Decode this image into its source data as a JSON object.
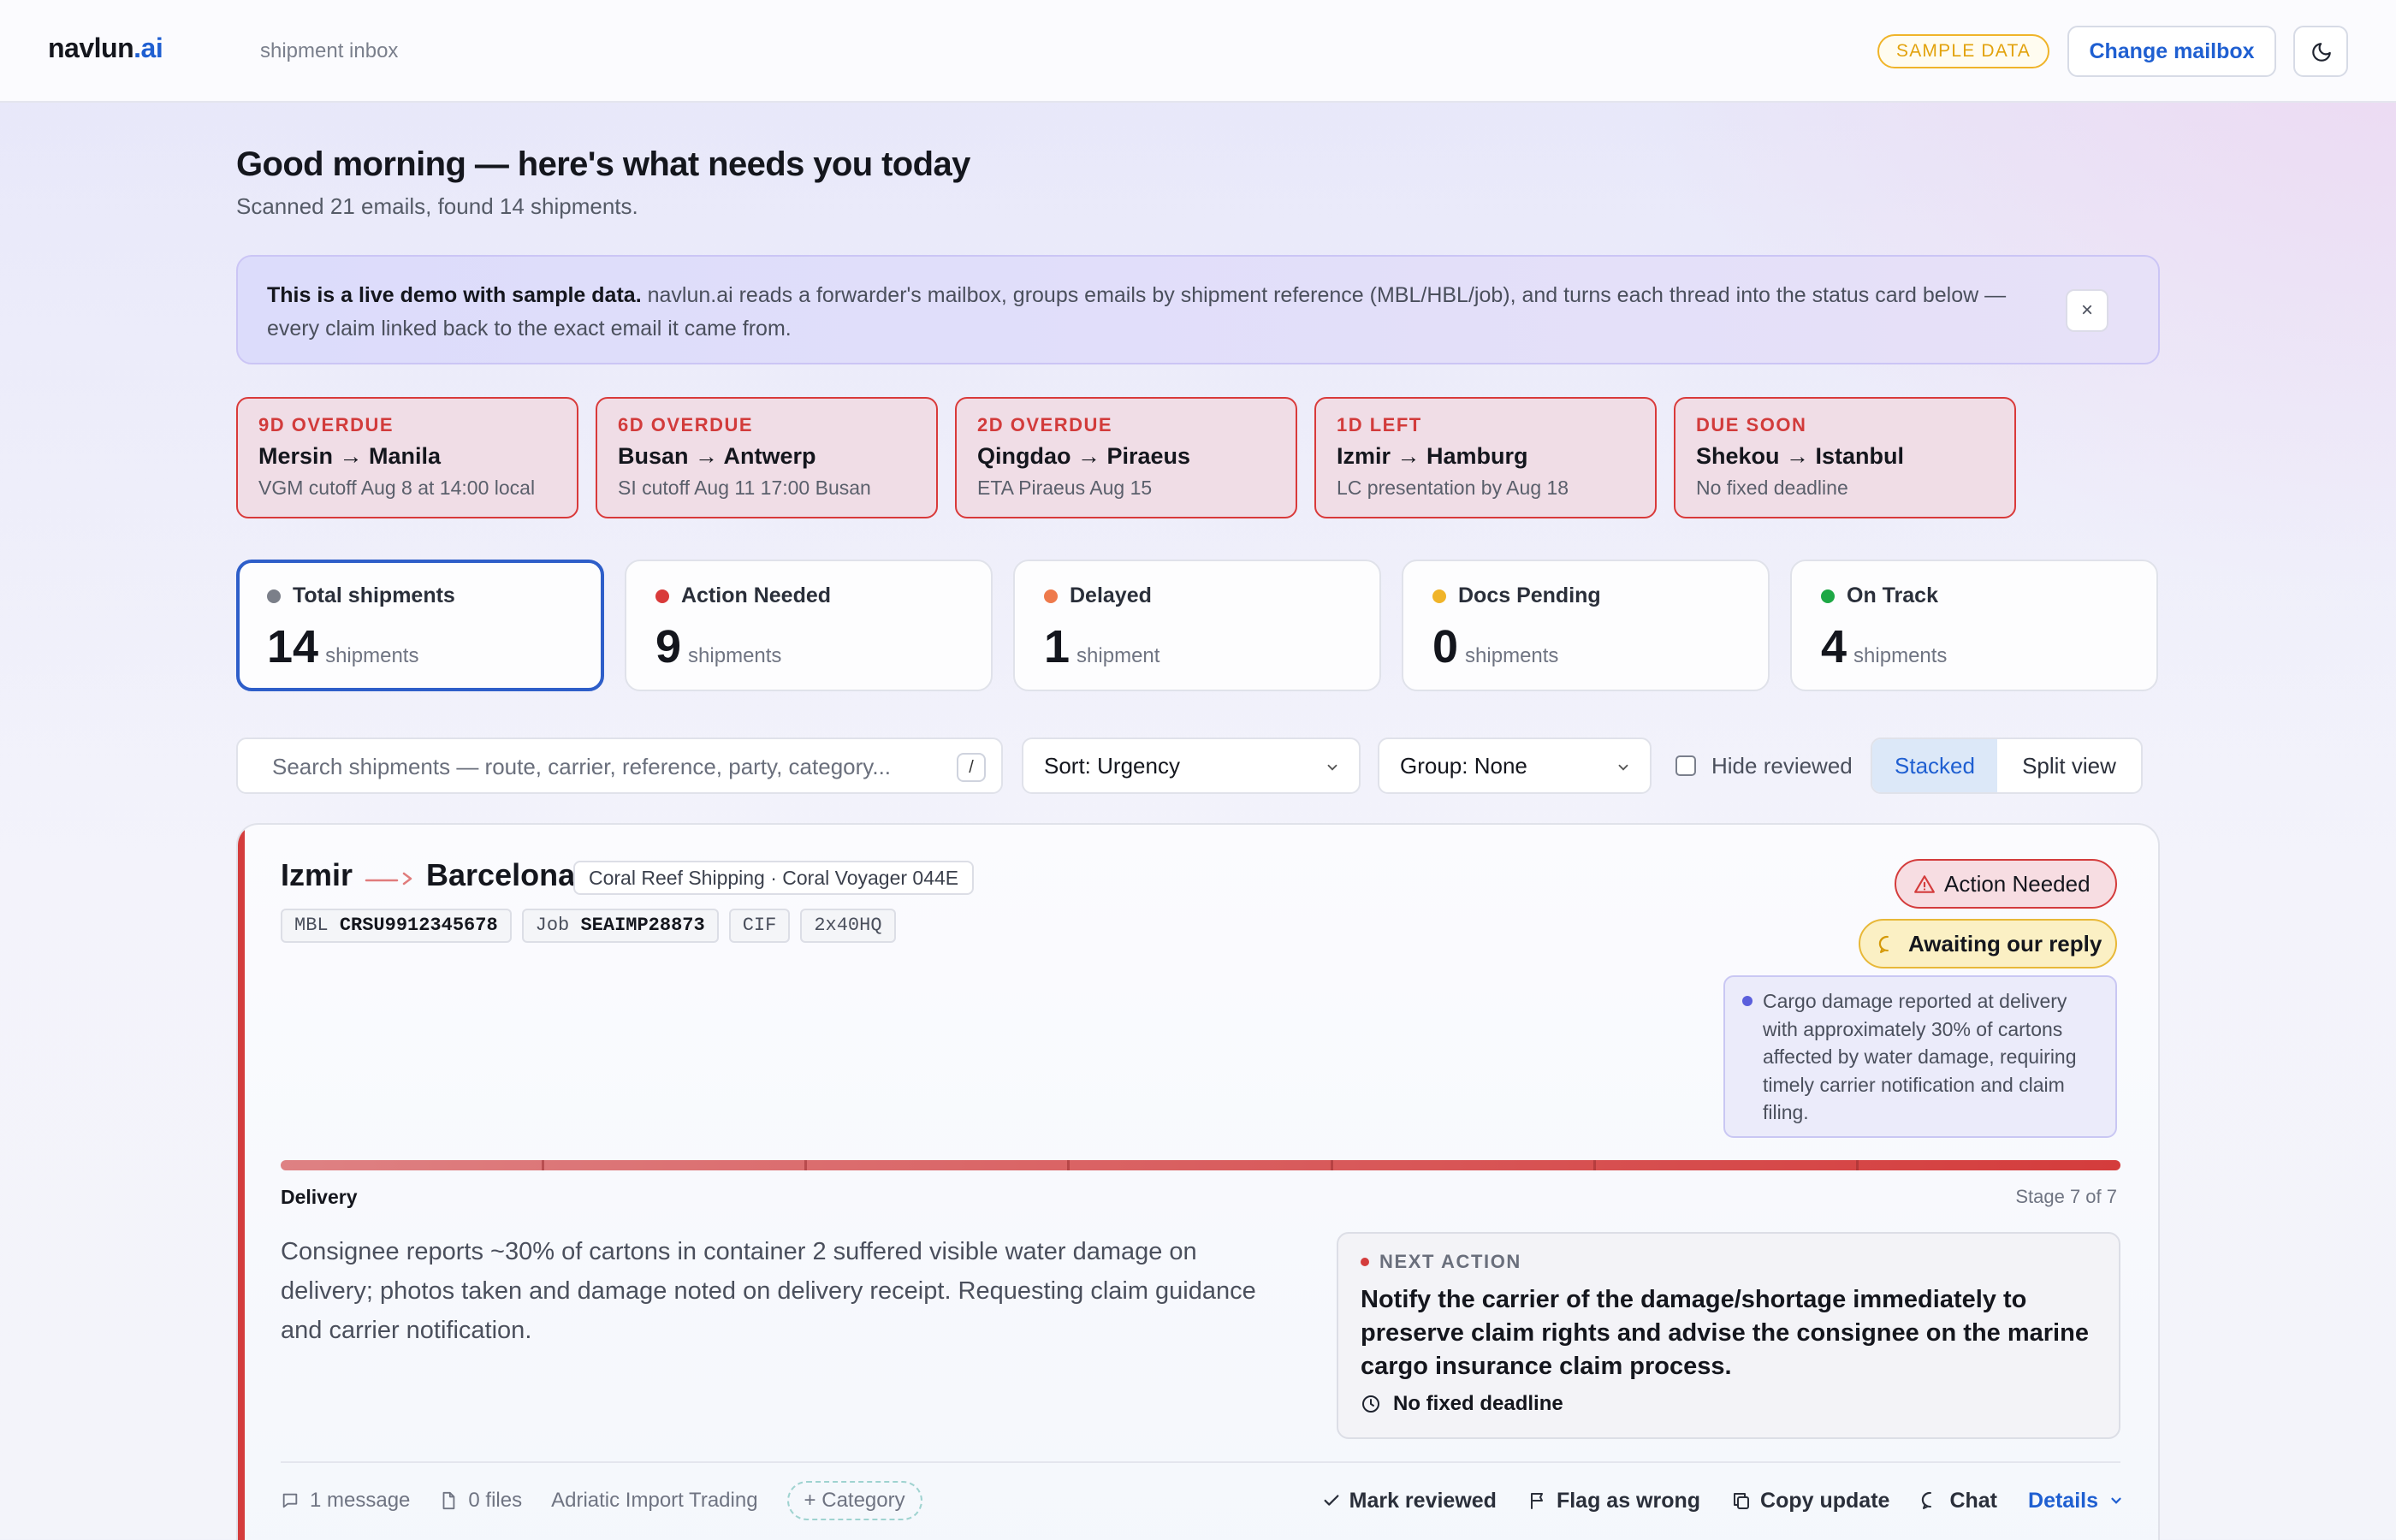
{
  "header": {
    "logo_main": "navlun",
    "logo_accent": ".ai",
    "subtitle": "shipment inbox",
    "sample_badge": "SAMPLE DATA",
    "change_mailbox": "Change mailbox",
    "theme_icon": "moon-icon"
  },
  "greeting": {
    "title": "Good morning — here's what needs you today",
    "scanned": "Scanned 21 emails, found 14 shipments."
  },
  "banner": {
    "bold": "This is a live demo with sample data.",
    "text": " navlun.ai reads a forwarder's mailbox, groups emails by shipment reference (MBL/HBL/job), and turns each thread into the status card below — every claim linked back to the exact email it came from.",
    "close": "×"
  },
  "deadlines": [
    {
      "status": "9D OVERDUE",
      "route": "Mersin → Manila",
      "note": "VGM cutoff Aug 8 at 14:00 local"
    },
    {
      "status": "6D OVERDUE",
      "route": "Busan → Antwerp",
      "note": "SI cutoff Aug 11 17:00 Busan"
    },
    {
      "status": "2D OVERDUE",
      "route": "Qingdao → Piraeus",
      "note": "ETA Piraeus Aug 15"
    },
    {
      "status": "1D LEFT",
      "route": "Izmir → Hamburg",
      "note": "LC presentation by Aug 18"
    },
    {
      "status": "DUE SOON",
      "route": "Shekou → Istanbul",
      "note": "No fixed deadline"
    }
  ],
  "stats": [
    {
      "label": "Total shipments",
      "value": "14",
      "unit": "shipments",
      "color": "#7b7f89"
    },
    {
      "label": "Action Needed",
      "value": "9",
      "unit": "shipments",
      "color": "#d93a3a"
    },
    {
      "label": "Delayed",
      "value": "1",
      "unit": "shipment",
      "color": "#ee7a4c"
    },
    {
      "label": "Docs Pending",
      "value": "0",
      "unit": "shipments",
      "color": "#f0b429"
    },
    {
      "label": "On Track",
      "value": "4",
      "unit": "shipments",
      "color": "#1ea845"
    }
  ],
  "toolbar": {
    "search_placeholder": "Search shipments — route, carrier, reference, party, category...",
    "search_kbd": "/",
    "sort": "Sort: Urgency",
    "group": "Group: None",
    "hide_reviewed": "Hide reviewed",
    "view_stacked": "Stacked",
    "view_split": "Split view"
  },
  "shipment": {
    "origin": "Izmir",
    "destination": "Barcelona",
    "carrier": "Coral Reef Shipping · Coral Voyager 044E",
    "mbl_label": "MBL",
    "mbl": "CRSU9912345678",
    "job_label": "Job",
    "job": "SEAIMP28873",
    "incoterm": "CIF",
    "equipment": "2x40HQ",
    "status": "Action Needed",
    "awaiting": "Awaiting our reply",
    "insight": "Cargo damage reported at delivery with approximately 30% of cartons affected by water damage, requiring timely carrier notification and claim filing.",
    "stage_name": "Delivery",
    "stage_progress": "Stage 7 of 7",
    "summary": "Consignee reports ~30% of cartons in container 2 suffered visible water damage on delivery; photos taken and damage noted on delivery receipt. Requesting claim guidance and carrier notification.",
    "next_action_label": "NEXT ACTION",
    "next_action": "Notify the carrier of the damage/shortage immediately to preserve claim rights and advise the consignee on the marine cargo insurance claim process.",
    "deadline": "No fixed deadline",
    "messages": "1 message",
    "files": "0 files",
    "party": "Adriatic Import Trading",
    "category": "+ Category",
    "mark_reviewed": "Mark reviewed",
    "flag_wrong": "Flag as wrong",
    "copy_update": "Copy update",
    "chat": "Chat",
    "details": "Details"
  }
}
